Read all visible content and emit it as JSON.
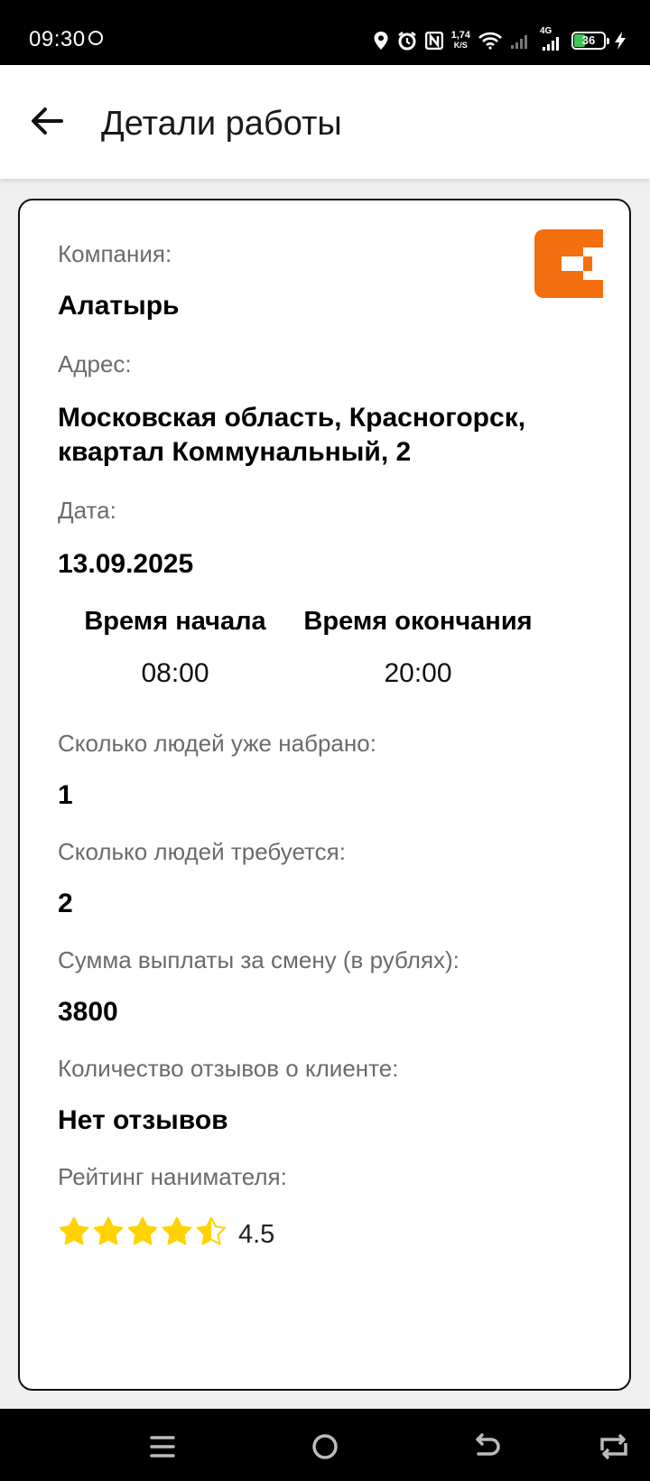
{
  "status_bar": {
    "time": "09:30",
    "net_speed_value": "1,74",
    "net_speed_unit": "K/S",
    "network_type": "4G",
    "battery_level": "36",
    "icons": [
      "location-icon",
      "alarm-icon",
      "nfc-icon",
      "wifi-icon",
      "signal-icon",
      "battery-icon",
      "charging-icon"
    ]
  },
  "app_bar": {
    "back_icon": "arrow-left-icon",
    "title": "Детали работы"
  },
  "details": {
    "company_label": "Компания:",
    "company_value": "Алатырь",
    "address_label": "Адрес:",
    "address_line1": "Московская область, Красногорск,",
    "address_line2": "квартал Коммунальный, 2",
    "date_label": "Дата:",
    "date_value": "13.09.2025",
    "start_time_label": "Время начала",
    "start_time_value": "08:00",
    "end_time_label": "Время окончания",
    "end_time_value": "20:00",
    "hired_label": "Сколько людей уже набрано:",
    "hired_value": "1",
    "required_label": "Сколько людей требуется:",
    "required_value": "2",
    "payment_label": "Сумма выплаты за смену (в рублях):",
    "payment_value": "3800",
    "reviews_label": "Количество отзывов о клиенте:",
    "reviews_value": "Нет отзывов",
    "rating_label": "Рейтинг нанимателя:",
    "rating_value": "4.5",
    "rating_stars_filled": 4.5,
    "rating_stars_max": 5
  },
  "colors": {
    "logo_orange": "#f36f10",
    "star_yellow": "#ffd200",
    "label_gray": "#6b6b6b"
  },
  "nav_bar": {
    "icons": [
      "menu-icon",
      "home-circle-icon",
      "back-icon",
      "recent-apps-icon"
    ]
  }
}
